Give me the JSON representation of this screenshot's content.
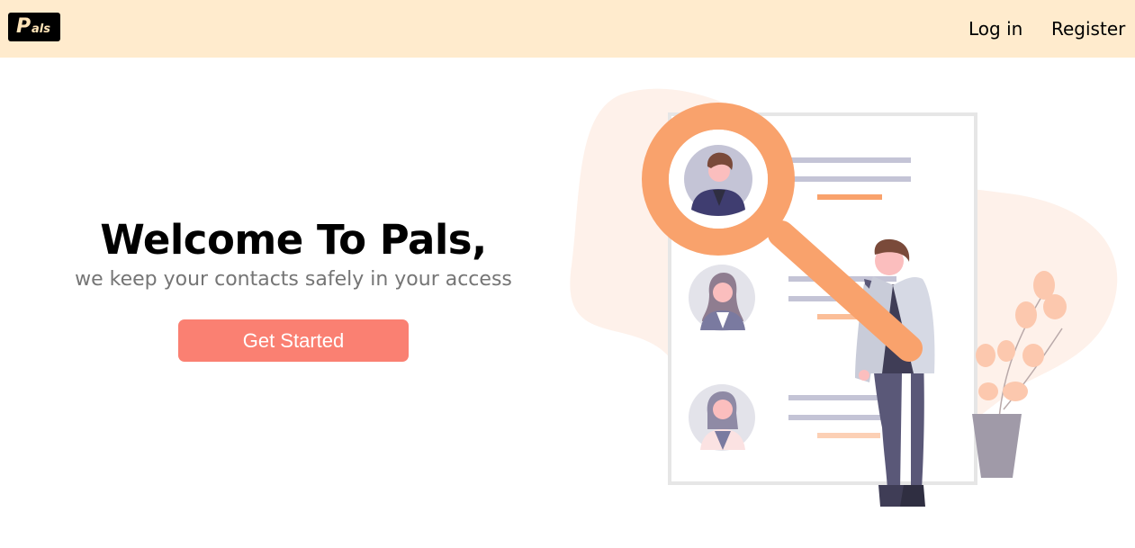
{
  "navbar": {
    "logo": {
      "big_letter": "P",
      "rest": "als"
    },
    "links": {
      "login": "Log in",
      "register": "Register"
    }
  },
  "hero": {
    "title": "Welcome To Pals,",
    "subtitle": "we keep your contacts safely in your access",
    "cta_label": "Get Started"
  },
  "colors": {
    "navbar_bg": "#ffebcd",
    "accent": "#fa8072",
    "illustration_orange": "#f9a26c",
    "illustration_purple": "#5a5878"
  },
  "illustration": {
    "icons": [
      "magnifying-glass-icon",
      "contact-avatar-icon",
      "person-figure",
      "plant-icon"
    ]
  }
}
